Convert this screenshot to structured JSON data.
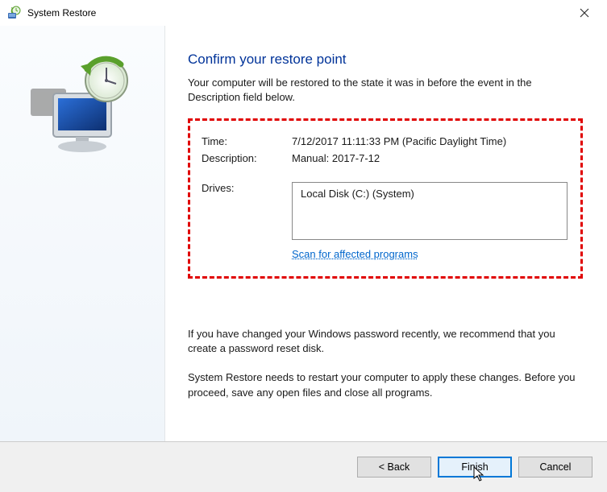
{
  "window": {
    "title": "System Restore"
  },
  "main": {
    "heading": "Confirm your restore point",
    "subtext": "Your computer will be restored to the state it was in before the event in the Description field below.",
    "time_label": "Time:",
    "time_value": "7/12/2017 11:11:33 PM (Pacific Daylight Time)",
    "description_label": "Description:",
    "description_value": "Manual: 2017-7-12",
    "drives_label": "Drives:",
    "drives_value": "Local Disk (C:) (System)",
    "scan_link": "Scan for affected programs",
    "note1": "If you have changed your Windows password recently, we recommend that you create a password reset disk.",
    "note2": "System Restore needs to restart your computer to apply these changes. Before you proceed, save any open files and close all programs."
  },
  "buttons": {
    "back": "< Back",
    "finish": "Finish",
    "cancel": "Cancel"
  }
}
